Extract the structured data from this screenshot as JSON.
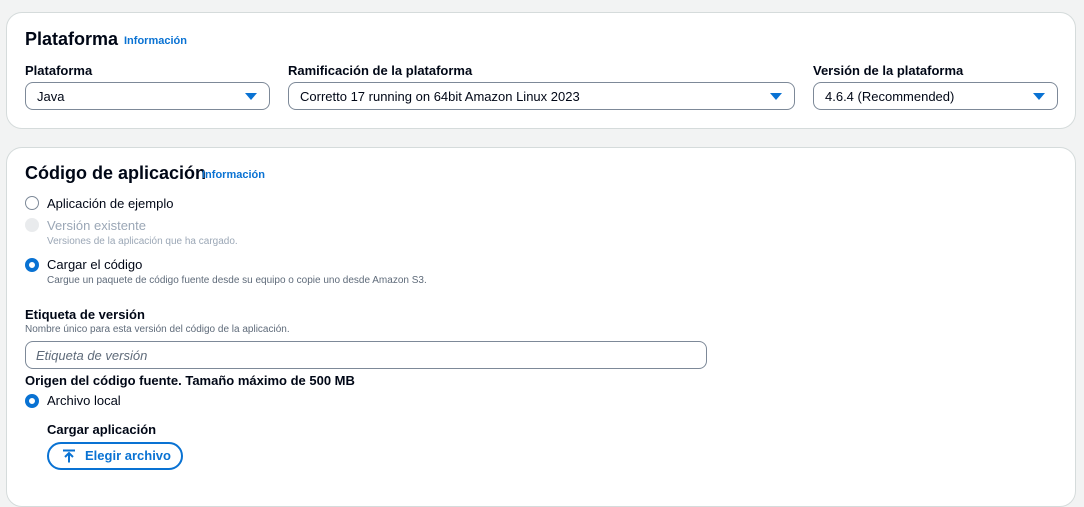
{
  "platform_section": {
    "title": "Plataforma",
    "info": "Información",
    "fields": [
      {
        "label": "Plataforma",
        "value": "Java"
      },
      {
        "label": "Ramificación de la plataforma",
        "value": "Corretto 17 running on 64bit Amazon Linux 2023"
      },
      {
        "label": "Versión de la plataforma",
        "value": "4.6.4 (Recommended)"
      }
    ]
  },
  "code_section": {
    "title": "Código de aplicación",
    "info": "Información",
    "options": [
      {
        "label": "Aplicación de ejemplo",
        "description": "",
        "state": "unchecked"
      },
      {
        "label": "Versión existente",
        "description": "Versiones de la aplicación que ha cargado.",
        "state": "disabled"
      },
      {
        "label": "Cargar el código",
        "description": "Cargue un paquete de código fuente desde su equipo o copie uno desde Amazon S3.",
        "state": "checked"
      }
    ],
    "version_label": {
      "label": "Etiqueta de versión",
      "description": "Nombre único para esta versión del código de la aplicación.",
      "placeholder": "Etiqueta de versión",
      "value": ""
    },
    "source_origin": {
      "label": "Origen del código fuente. Tamaño máximo de 500 MB",
      "option": "Archivo local",
      "option_state": "checked"
    },
    "upload": {
      "label": "Cargar aplicación",
      "button": "Elegir archivo",
      "button_icon": "upload-arrow-icon"
    }
  },
  "colors": {
    "accent": "#0972d3",
    "text": "#000716",
    "muted": "#5f6b7a",
    "disabled": "#9ba7b6",
    "border": "#7d8998"
  }
}
